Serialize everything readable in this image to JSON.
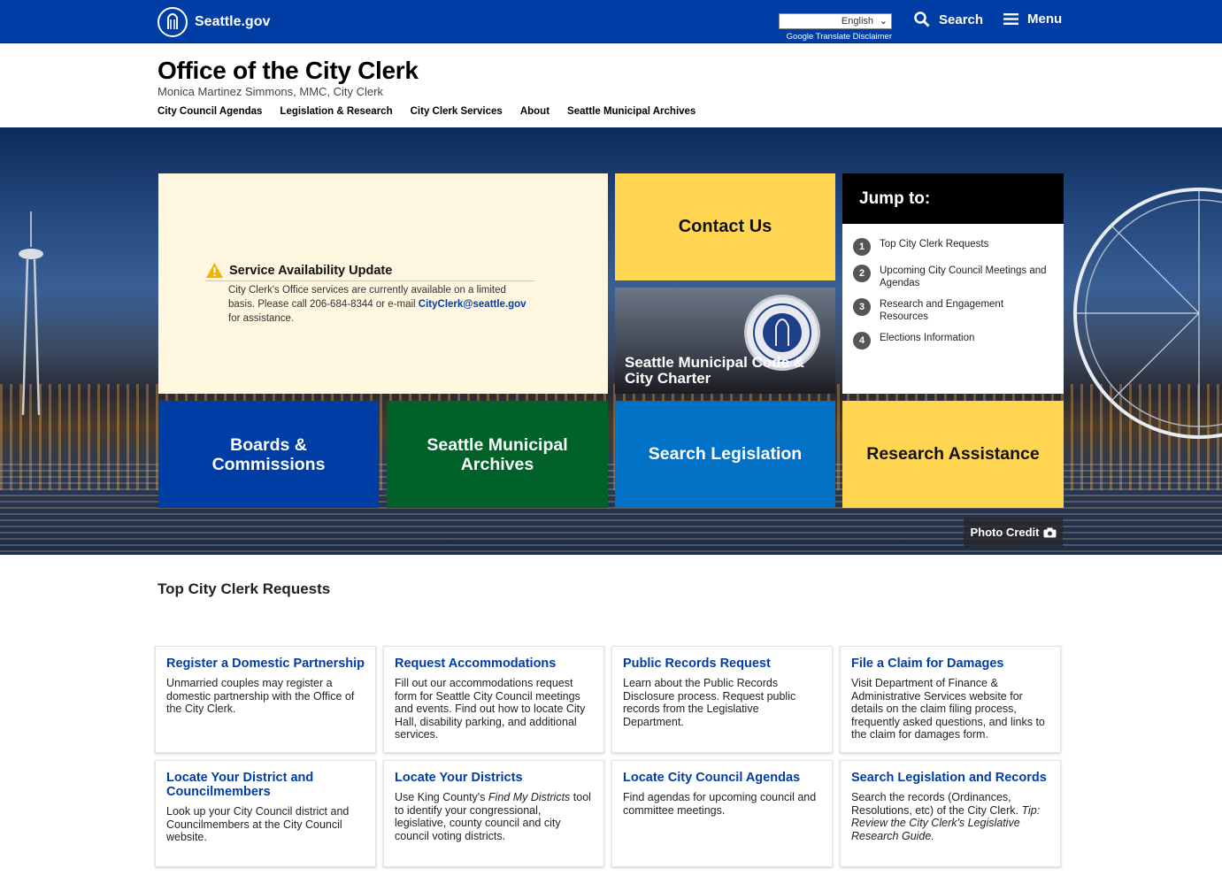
{
  "topbar": {
    "logo_text": "Seattle.gov",
    "language_selected": "English",
    "translate_disclaimer": "Google Translate Disclaimer",
    "search_label": "Search",
    "menu_label": "Menu"
  },
  "header": {
    "title": "Office of the City Clerk",
    "subtitle": "Monica Martinez Simmons, MMC, City Clerk",
    "nav": [
      "City Council Agendas",
      "Legislation & Research",
      "City Clerk Services",
      "About",
      "Seattle Municipal Archives"
    ]
  },
  "hero": {
    "notice": {
      "title": "Service Availability Update",
      "body_before": "City Clerk's Office services are currently available on a limited basis. Please call 206-684-8344 or e-mail ",
      "email": "CityClerk@seattle.gov",
      "body_after": " for assistance."
    },
    "contact_label": "Contact Us",
    "smc_label": "Seattle Municipal Code & City Charter",
    "jump": {
      "heading": "Jump to:",
      "items": [
        {
          "num": "1",
          "label": "Top City Clerk Requests"
        },
        {
          "num": "2",
          "label": "Upcoming City Council Meetings and Agendas"
        },
        {
          "num": "3",
          "label": "Research and Engagement Resources"
        },
        {
          "num": "4",
          "label": "Elections Information"
        }
      ]
    },
    "boards_label": "Boards & Commissions",
    "archives_label": "Seattle Municipal Archives",
    "search_legislation_label": "Search Legislation",
    "research_label": "Research Assistance",
    "photo_credit": "Photo Credit"
  },
  "requests": {
    "heading": "Top City Clerk Requests",
    "cards": [
      {
        "title": "Register a Domestic Partnership",
        "text": "Unmarried couples may register a domestic partnership with the Office of the City Clerk."
      },
      {
        "title": "Request Accommodations",
        "text": "Fill out our accommodations request form for Seattle City Council meetings and events. Find out how to locate City Hall, disability parking, and additional services."
      },
      {
        "title": "Public Records Request",
        "text": "Learn about the Public Records Disclosure process. Request public records from the Legislative Department."
      },
      {
        "title": "File a Claim for Damages",
        "text": "Visit Department of Finance & Administrative Services website for details on the claim filing process, frequently asked questions, and links to the claim for damages form."
      },
      {
        "title": "Locate Your District and Councilmembers",
        "text": "Look up your City Council district and Councilmembers at the City Council website."
      },
      {
        "title": "Locate Your Districts",
        "text_before": "Use King County's ",
        "text_em": "Find My Districts",
        "text_after": " tool to identify your congressional, legislative, county council and city council voting districts."
      },
      {
        "title": "Locate City Council Agendas",
        "text": "Find agendas for upcoming council and committee meetings."
      },
      {
        "title": "Search Legislation and Records",
        "text_before": "Search the records (Ordinances, Resolutions, etc) of the City Clerk. ",
        "text_em": "Tip: Review the City Clerk's Legislative Research Guide."
      }
    ]
  },
  "colors": {
    "brand_blue": "#003da5",
    "yellow": "#ffd552",
    "green": "#006129",
    "light_blue": "#0071c5",
    "notice_bg": "#fff6e0"
  }
}
